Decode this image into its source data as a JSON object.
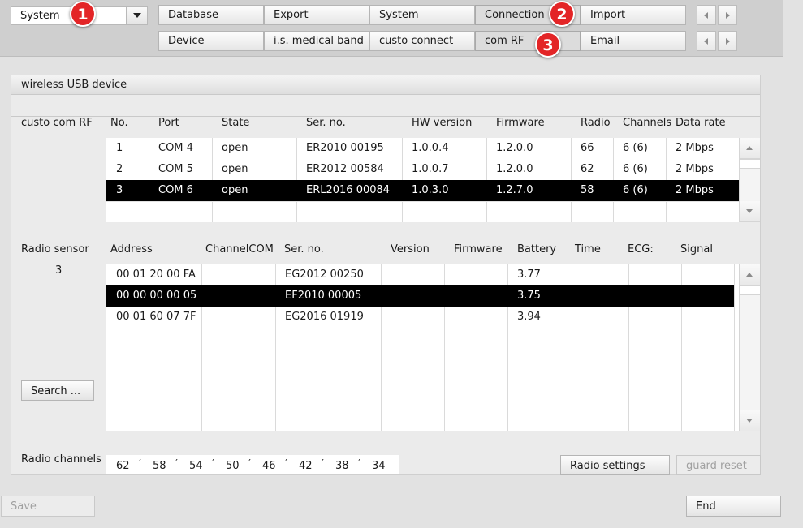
{
  "header": {
    "module_select": "System",
    "tabs_row1": [
      "Database",
      "Export",
      "System",
      "Connection",
      "Import"
    ],
    "tabs_row2": [
      "Device",
      "i.s. medical band",
      "custo connect",
      "com RF",
      "Email"
    ],
    "badges": [
      "1",
      "2",
      "3"
    ]
  },
  "panel": {
    "title": "wireless USB device",
    "device_section_label": "custo com RF",
    "device_columns": [
      "No.",
      "Port",
      "State",
      "Ser. no.",
      "HW version",
      "Firmware",
      "Radio",
      "Channels",
      "Data rate"
    ],
    "device_rows": [
      [
        "1",
        "COM 4",
        "open",
        "ER2010 00195",
        "1.0.0.4",
        "1.2.0.0",
        "66",
        "6 (6)",
        "2 Mbps"
      ],
      [
        "2",
        "COM 5",
        "open",
        "ER2012 00584",
        "1.0.0.7",
        "1.2.0.0",
        "62",
        "6 (6)",
        "2 Mbps"
      ],
      [
        "3",
        "COM 6",
        "open",
        "ERL2016 00084",
        "1.0.3.0",
        "1.2.7.0",
        "58",
        "6 (6)",
        "2 Mbps"
      ]
    ],
    "sensor_section_label": "Radio sensor",
    "sensor_count": "3",
    "sensor_columns": [
      "Address",
      "ChannelCOM",
      "Ser. no.",
      "Version",
      "Firmware",
      "Battery",
      "Time",
      "ECG:",
      "Signal"
    ],
    "sensor_rows": [
      [
        "00 01 20 00 FA",
        "",
        "",
        "EG2012 00250",
        "",
        "",
        "3.77",
        "",
        "",
        ""
      ],
      [
        "00 00 00 00 05",
        "",
        "",
        "EF2010 00005",
        "",
        "",
        "3.75",
        "",
        "",
        ""
      ],
      [
        "00 01 60 07 7F",
        "",
        "",
        "EG2016 01919",
        "",
        "",
        "3.94",
        "",
        "",
        ""
      ]
    ],
    "search_button": "Search ...",
    "channels_label": "Radio channels",
    "channels": [
      "62",
      "58",
      "54",
      "50",
      "46",
      "42",
      "38",
      "34"
    ],
    "radio_settings_button": "Radio settings",
    "guard_reset_button": "guard reset"
  },
  "footer": {
    "save_button": "Save",
    "end_button": "End"
  },
  "colors": {
    "badge": "#e32527",
    "selected_row": "#000000"
  }
}
